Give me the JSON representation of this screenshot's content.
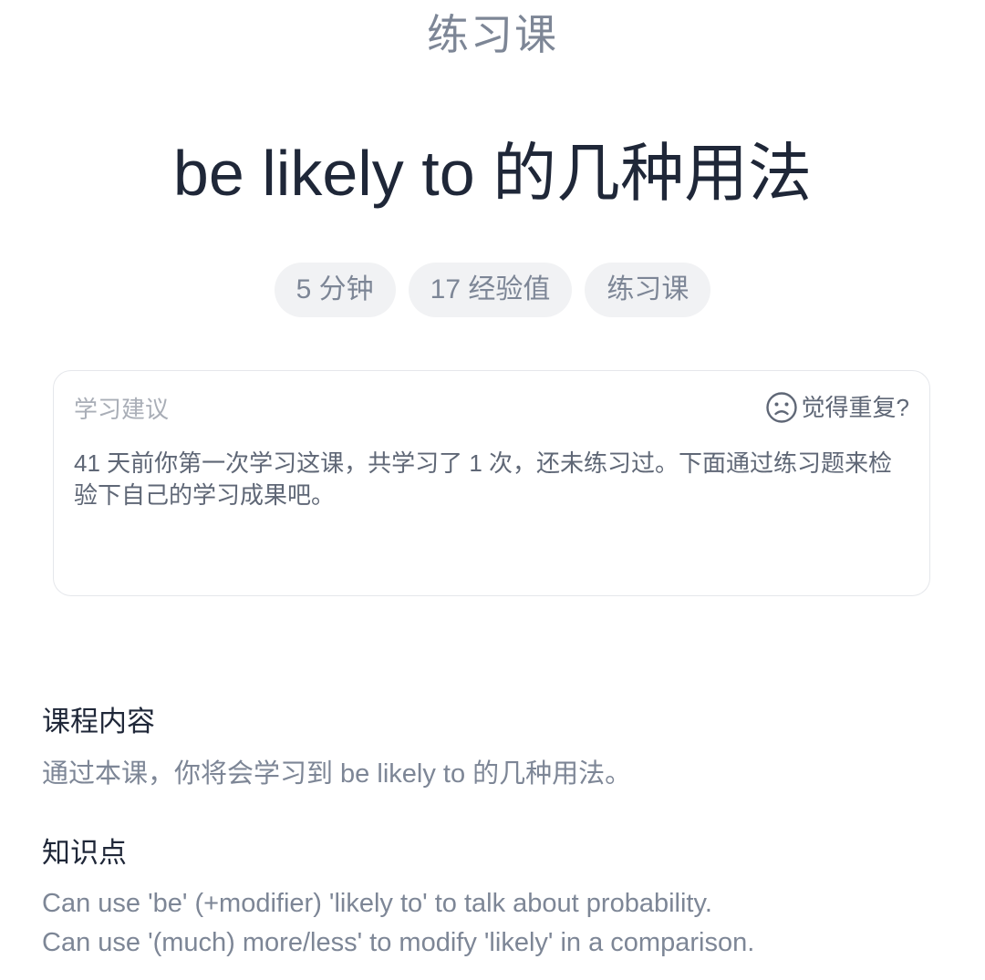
{
  "header": {
    "lesson_type": "练习课",
    "title": "be likely to 的几种用法"
  },
  "tags": [
    {
      "label": "5 分钟"
    },
    {
      "label": "17 经验值"
    },
    {
      "label": "练习课"
    }
  ],
  "advice": {
    "label": "学习建议",
    "repeat_label": "觉得重复?",
    "repeat_icon": "sad-face-icon",
    "text": "41 天前你第一次学习这课，共学习了 1 次，还未练习过。下面通过练习题来检验下自己的学习成果吧。"
  },
  "course_content": {
    "heading": "课程内容",
    "text": "通过本课，你将会学习到 be likely to 的几种用法。"
  },
  "knowledge": {
    "heading": "知识点",
    "items": [
      "Can use 'be' (+modifier) 'likely to' to talk about probability.",
      "Can use '(much) more/less' to modify 'likely' in a comparison."
    ]
  },
  "colors": {
    "title": "#1f2738",
    "muted": "#7d8696",
    "tag_bg": "#f1f2f4",
    "card_border": "#e5e7eb"
  }
}
